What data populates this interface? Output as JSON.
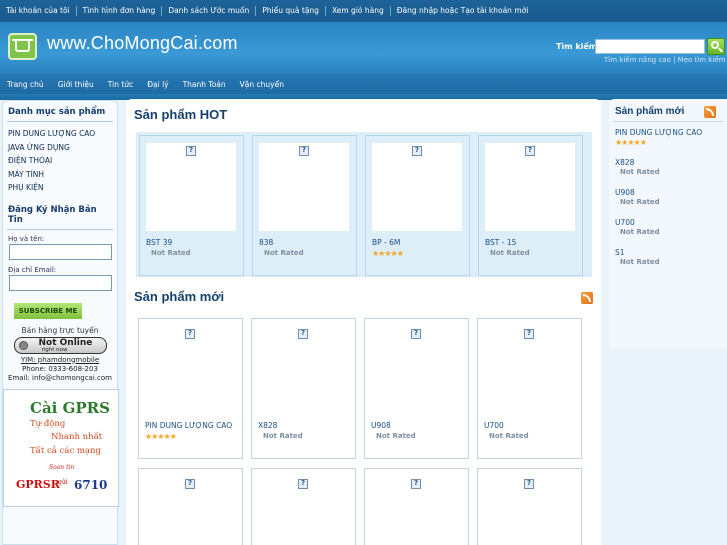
{
  "topbar": {
    "links": [
      "Tài khoản của tôi",
      "Tình hình đơn hàng",
      "Danh sách Ước muốn",
      "Phiếu quà tặng",
      "Xem giỏ hàng",
      "Đăng nhập hoặc Tạo tài khoản mới"
    ]
  },
  "header": {
    "site_title": "www.ChoMongCai.com",
    "search_label": "Tìm kiếm",
    "search_value": "",
    "adv_links": "Tìm kiếm nâng cao | Mẹo tìm kiếm"
  },
  "nav": {
    "items": [
      "Trang chủ",
      "Giới thiệu",
      "Tin tức",
      "Đại lý",
      "Thanh Toán",
      "Vận chuyển"
    ]
  },
  "left": {
    "categories_title": "Danh mục sản phẩm",
    "categories": [
      "PIN DUNG LƯỢNG CAO",
      "JAVA ỨNG DỤNG",
      "ĐIỆN THOẠI",
      "MÁY TÍNH",
      "PHỤ KIỆN"
    ],
    "newsletter_title": "Đăng Ký Nhận Bản Tin",
    "name_label": "Họ và tên:",
    "email_label": "Địa chỉ Email:",
    "subscribe_label": "SUBSCRIBE ME",
    "sale_text": "Bán hàng trực tuyến",
    "online_status": "Not Online",
    "online_sub": "right now",
    "ym": "YIM: phamdongmobile",
    "phone": "Phone: 0333-608-203",
    "email": "Email: info@chomongcai.com",
    "ad": {
      "line1": "Cài GPRS",
      "line2": "Tự động",
      "line3": "Nhanh nhất",
      "line4": "Tất cả các mạng",
      "line5": "Soạn tin",
      "line6": "GPRSR",
      "line7": "gửi",
      "line8": "6710"
    }
  },
  "main": {
    "hot_title": "Sản phẩm HOT",
    "hot_products": [
      {
        "name": "BST 39",
        "rating": "Not Rated",
        "stars": ""
      },
      {
        "name": "838",
        "rating": "Not Rated",
        "stars": ""
      },
      {
        "name": "BP - 6M",
        "rating": "",
        "stars": "★★★★★"
      },
      {
        "name": "BST - 15",
        "rating": "Not Rated",
        "stars": ""
      }
    ],
    "new_title": "Sản phẩm mới",
    "new_products": [
      {
        "name": "PIN DUNG LƯỢNG CAO",
        "rating": "",
        "stars": "★★★★★"
      },
      {
        "name": "X828",
        "rating": "Not Rated",
        "stars": ""
      },
      {
        "name": "U908",
        "rating": "Not Rated",
        "stars": ""
      },
      {
        "name": "U700",
        "rating": "Not Rated",
        "stars": ""
      }
    ]
  },
  "right": {
    "title": "Sản phẩm mới",
    "items": [
      {
        "name": "PIN DUNG LƯỢNG CAO",
        "rating": "",
        "stars": "★★★★★"
      },
      {
        "name": "X828",
        "rating": "Not Rated",
        "stars": ""
      },
      {
        "name": "U908",
        "rating": "Not Rated",
        "stars": ""
      },
      {
        "name": "U700",
        "rating": "Not Rated",
        "stars": ""
      },
      {
        "name": "S1",
        "rating": "Not Rated",
        "stars": ""
      }
    ]
  }
}
